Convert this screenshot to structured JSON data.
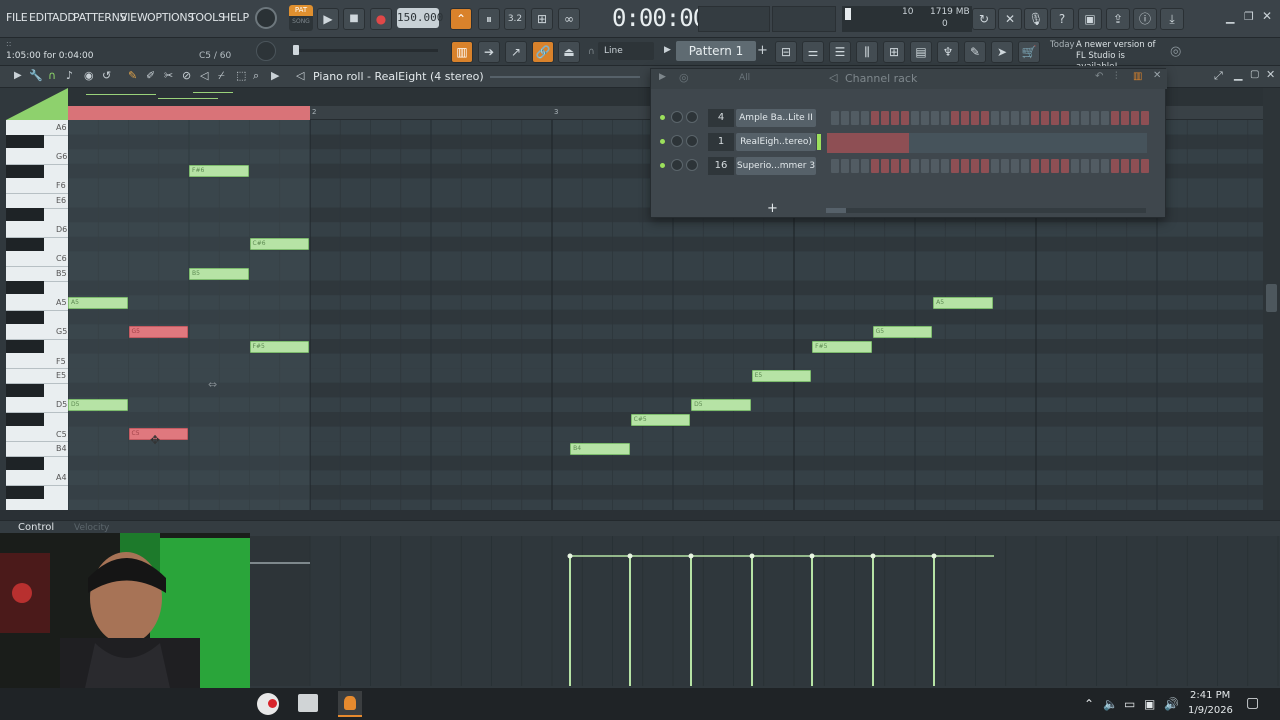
{
  "menu": [
    "FILE",
    "EDIT",
    "ADD",
    "PATTERNS",
    "VIEW",
    "OPTIONS",
    "TOOLS",
    "HELP"
  ],
  "transport": {
    "pat_song": "PAT",
    "song_label": "SONG",
    "tempo": "150.000",
    "time": "0:00:00",
    "cpu_num": "10",
    "memory": "1719 MB",
    "poly": "0",
    "step_label": "3.2"
  },
  "status": {
    "time_range": "1:05:00 for 0:04:00",
    "note_pos": "C5 / 60"
  },
  "pattern": {
    "snap": "Line",
    "name": "Pattern 1"
  },
  "news": {
    "day": "Today",
    "message": "A newer version of FL Studio is available!"
  },
  "piano_roll": {
    "title": "Piano roll - RealEight (4 stereo)",
    "ruler": [
      "2",
      "3"
    ],
    "key_labels": [
      "A6",
      "G6",
      "F6",
      "E6",
      "D6",
      "C6",
      "B5",
      "A5",
      "G5",
      "F5",
      "E5",
      "D5",
      "C5",
      "B4",
      "A4"
    ],
    "notes": [
      {
        "label": "F#6",
        "selected": false
      },
      {
        "label": "C#6",
        "selected": false
      },
      {
        "label": "B5",
        "selected": false
      },
      {
        "label": "A5",
        "selected": false
      },
      {
        "label": "G5",
        "selected": true
      },
      {
        "label": "F#5",
        "selected": false
      },
      {
        "label": "D5",
        "selected": false
      },
      {
        "label": "C5",
        "selected": true
      },
      {
        "label": "B4",
        "selected": false
      },
      {
        "label": "C#5",
        "selected": false
      },
      {
        "label": "D5",
        "selected": false
      },
      {
        "label": "E5",
        "selected": false
      },
      {
        "label": "F#5",
        "selected": false
      },
      {
        "label": "G5",
        "selected": false
      },
      {
        "label": "A5",
        "selected": false
      }
    ]
  },
  "control": {
    "label": "Control",
    "target": "Velocity"
  },
  "channel_rack": {
    "title": "Channel rack",
    "filter": "All",
    "channels": [
      {
        "num": "4",
        "name": "Ample Ba..Lite II"
      },
      {
        "num": "1",
        "name": "RealEigh..tereo)"
      },
      {
        "num": "16",
        "name": "Superio...mmer 3"
      }
    ],
    "add": "+"
  },
  "taskbar": {
    "time": "2:41 PM",
    "date": "1/9/2026"
  }
}
